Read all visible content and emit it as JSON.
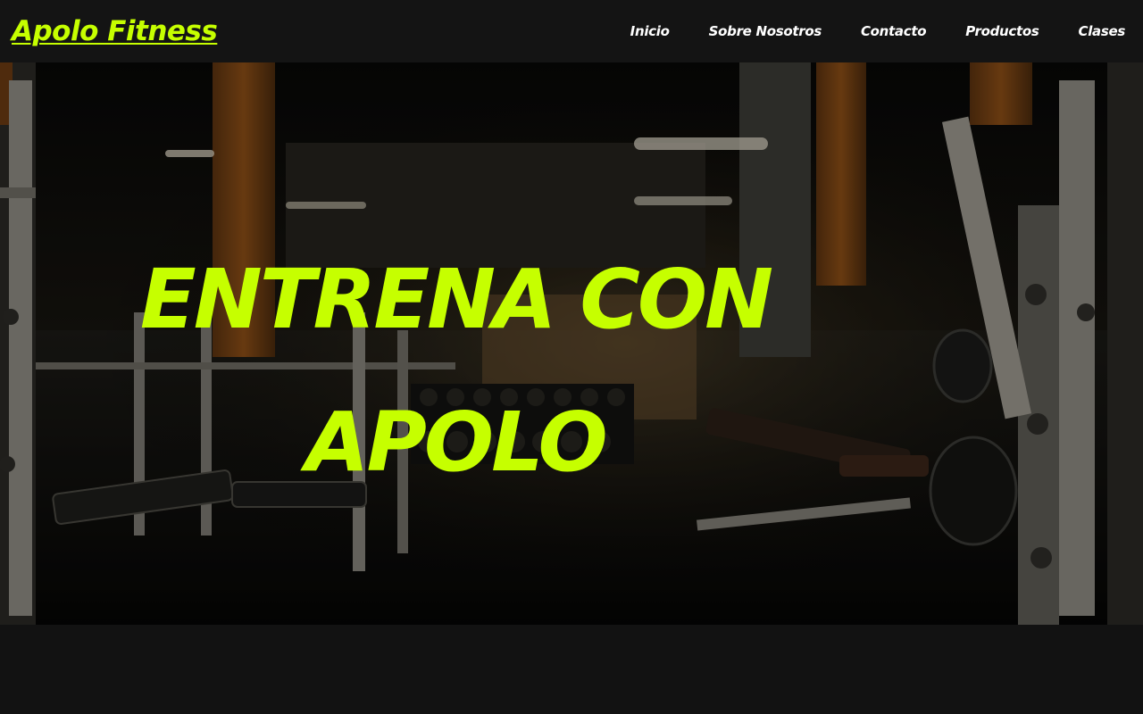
{
  "brand": {
    "name": "Apolo Fitness",
    "color": "#c6ff00"
  },
  "nav": {
    "items": [
      {
        "label": "Inicio"
      },
      {
        "label": "Sobre Nosotros"
      },
      {
        "label": "Contacto"
      },
      {
        "label": "Productos"
      },
      {
        "label": "Clases"
      }
    ]
  },
  "hero": {
    "title": "ENTRENA CON APOLO",
    "background": "gym interior photo with weight machines and benches"
  },
  "colors": {
    "accent": "#c6ff00",
    "nav_background": "#141414",
    "page_background": "#121212",
    "nav_text": "#ffffff"
  }
}
